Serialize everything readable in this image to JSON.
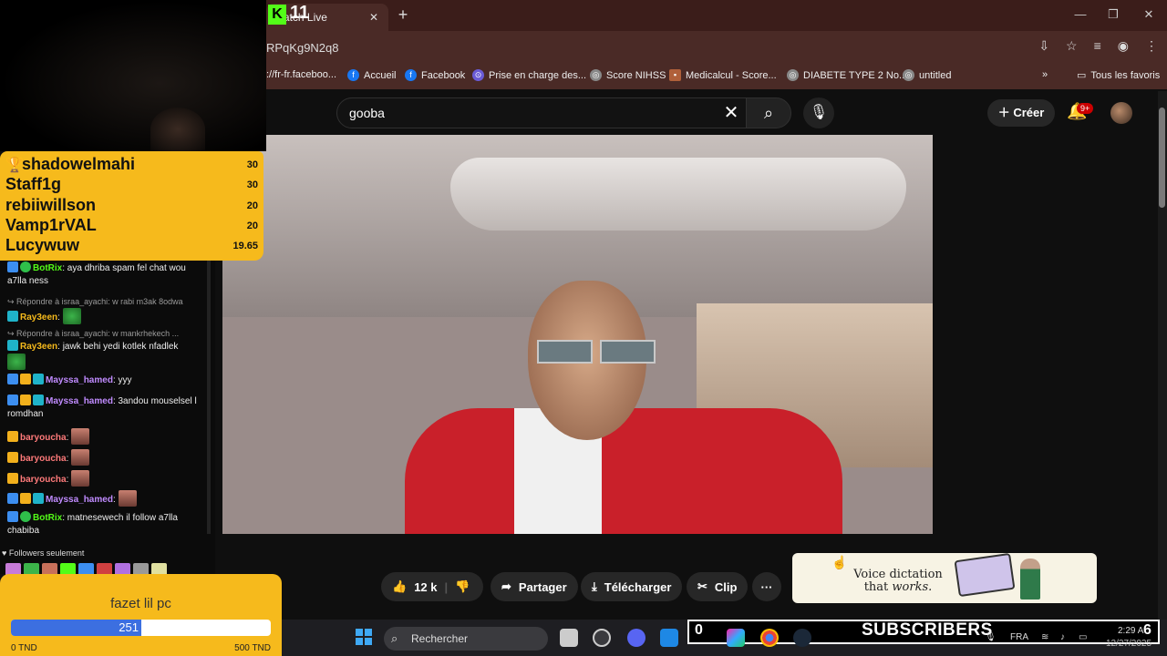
{
  "browser": {
    "tab_title": "Watch Live",
    "url_fragment": "RPqKg9N2q8",
    "bookmarks": [
      {
        "label": "://fr-fr.faceboo..."
      },
      {
        "label": "Accueil"
      },
      {
        "label": "Facebook"
      },
      {
        "label": "Prise en charge des..."
      },
      {
        "label": "Score NIHSS"
      },
      {
        "label": "Medicalcul - Score..."
      },
      {
        "label": "DIABETE TYPE 2 No..."
      },
      {
        "label": "untitled"
      }
    ],
    "bookmarks_more": "»",
    "all_favorites": "Tous les favoris"
  },
  "youtube": {
    "search_value": "gooba",
    "create_label": "Créer",
    "notif_badge": "9+",
    "actions": {
      "likes": "12 k",
      "share": "Partager",
      "download": "Télécharger",
      "clip": "Clip",
      "more": "···"
    },
    "ad": {
      "line1": "Voice dictation",
      "line2_prefix": "that ",
      "line2_emph": "works."
    }
  },
  "overlay": {
    "kick_logo": "K",
    "kick_number": "11",
    "leaderboard": [
      {
        "name": "shadowelmahi",
        "value": "30"
      },
      {
        "name": "Staff1g",
        "value": "30"
      },
      {
        "name": "rebiiwillson",
        "value": "20"
      },
      {
        "name": "Vamp1rVAL",
        "value": "20"
      },
      {
        "name": "Lucywuw",
        "value": "19.65"
      }
    ],
    "chat": [
      {
        "user": "BotRix",
        "user_color": "#53fc18",
        "text": ": aya dhriba spam fel chat wou a7lla ness"
      },
      {
        "reply": "↪ Répondre à israa_ayachi: w rabi m3ak 8odwa",
        "user": "Ray3een",
        "user_color": "#f6ba1c",
        "text": ":"
      },
      {
        "reply": "↪ Répondre à israa_ayachi: w mankrhekech ...",
        "user": "Ray3een",
        "user_color": "#f6ba1c",
        "text": ": jawk behi yedi kotlek nfadlek"
      },
      {
        "user": "Mayssa_hamed",
        "user_color": "#c08bff",
        "text": ": yyy"
      },
      {
        "user": "Mayssa_hamed",
        "user_color": "#c08bff",
        "text": ": 3andou mouselsel l romdhan"
      },
      {
        "user": "baryoucha",
        "user_color": "#ff7a7a",
        "text": ":"
      },
      {
        "user": "baryoucha",
        "user_color": "#ff7a7a",
        "text": ":"
      },
      {
        "user": "baryoucha",
        "user_color": "#ff7a7a",
        "text": ":"
      },
      {
        "user": "Mayssa_hamed",
        "user_color": "#c08bff",
        "text": ":"
      },
      {
        "user": "BotRix",
        "user_color": "#53fc18",
        "text": ": matnesewech il follow a7lla chabiba"
      }
    ],
    "followers_only": "♥ Followers seulement",
    "goal": {
      "title": "fazet lil pc",
      "current": "251",
      "min_label": "0 TND",
      "max_label": "500 TND",
      "fraction": 0.502
    }
  },
  "taskbar": {
    "search_placeholder": "Rechercher",
    "subs_count": "0",
    "subs_label": "SUBSCRIBERS",
    "subs_end": "6",
    "lang": "FRA",
    "time": "2:29 A",
    "date": "12/27/2025"
  },
  "colors": {
    "accent_youtube": "#cc0000",
    "overlay_yellow": "#f6ba1c",
    "goal_fill": "#3c6fe0",
    "browser_frame": "#4a2a26"
  }
}
